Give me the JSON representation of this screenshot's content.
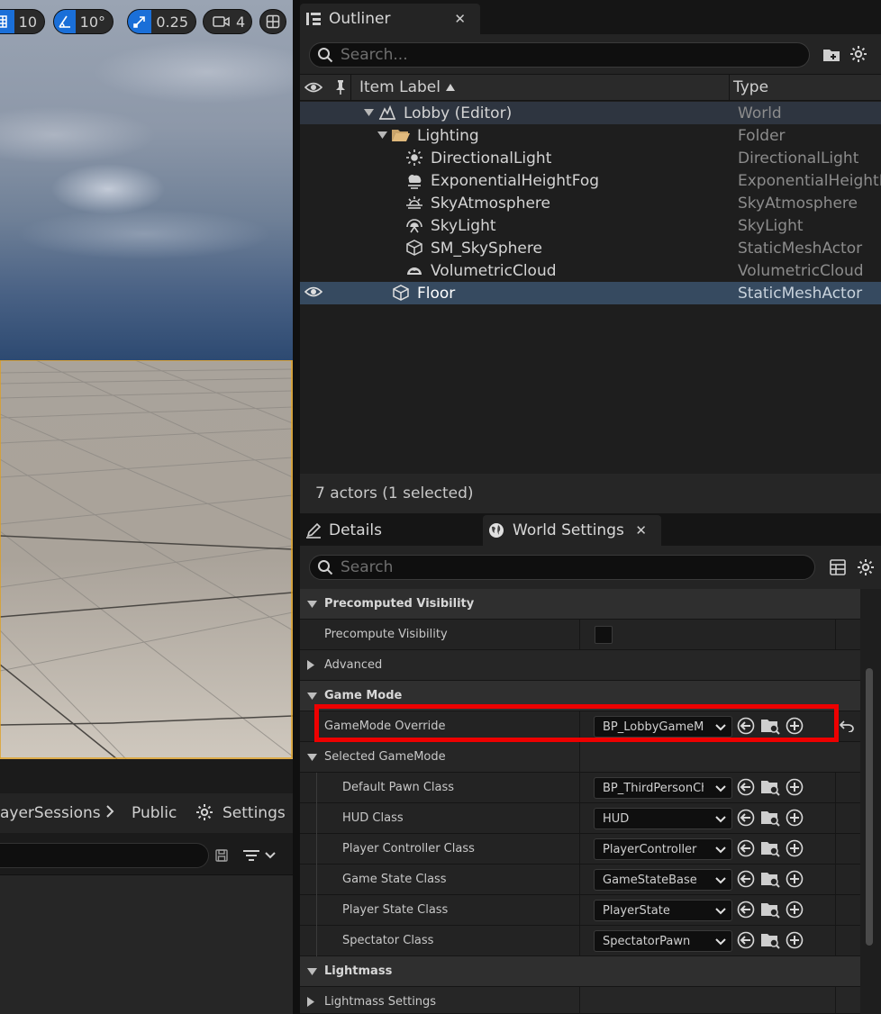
{
  "viewport": {
    "toolbar": {
      "grid_snap_value": "10",
      "rotation_snap_value": "10°",
      "scale_snap_value": "0.25",
      "camera_speed_value": "4"
    }
  },
  "content_browser": {
    "breadcrumb": [
      "ayerSessions",
      "Public"
    ],
    "settings_label": "Settings"
  },
  "outliner": {
    "tab_title": "Outliner",
    "search_placeholder": "Search...",
    "columns": {
      "label": "Item Label",
      "type": "Type"
    },
    "rows": [
      {
        "label": "Lobby (Editor)",
        "type": "World",
        "icon": "world-icon"
      },
      {
        "label": "Lighting",
        "type": "Folder",
        "icon": "folder-icon"
      },
      {
        "label": "DirectionalLight",
        "type": "DirectionalLight",
        "icon": "directional-light-icon"
      },
      {
        "label": "ExponentialHeightFog",
        "type": "ExponentialHeightFog",
        "icon": "height-fog-icon"
      },
      {
        "label": "SkyAtmosphere",
        "type": "SkyAtmosphere",
        "icon": "sky-atmosphere-icon"
      },
      {
        "label": "SkyLight",
        "type": "SkyLight",
        "icon": "sky-light-icon"
      },
      {
        "label": "SM_SkySphere",
        "type": "StaticMeshActor",
        "icon": "static-mesh-icon"
      },
      {
        "label": "VolumetricCloud",
        "type": "VolumetricCloud",
        "icon": "volumetric-cloud-icon"
      },
      {
        "label": "Floor",
        "type": "StaticMeshActor",
        "icon": "static-mesh-icon",
        "selected": true
      }
    ],
    "status": "7 actors (1 selected)"
  },
  "details": {
    "tabs": {
      "details": "Details",
      "world_settings": "World Settings"
    },
    "search_placeholder": "Search",
    "rows": {
      "precomputed_visibility": "Precomputed Visibility",
      "precompute_visibility": "Precompute Visibility",
      "advanced": "Advanced",
      "game_mode": "Game Mode",
      "gamemode_override": "GameMode Override",
      "gamemode_override_value": "BP_LobbyGameMode",
      "selected_gamemode": "Selected GameMode",
      "default_pawn_class": "Default Pawn Class",
      "default_pawn_value": "BP_ThirdPersonCharacter",
      "hud_class": "HUD Class",
      "hud_value": "HUD",
      "player_controller_class": "Player Controller Class",
      "player_controller_value": "PlayerController",
      "game_state_class": "Game State Class",
      "game_state_value": "GameStateBase",
      "player_state_class": "Player State Class",
      "player_state_value": "PlayerState",
      "spectator_class": "Spectator Class",
      "spectator_value": "SpectatorPawn",
      "lightmass": "Lightmass",
      "lightmass_settings": "Lightmass Settings"
    }
  },
  "colors": {
    "accent": "#1a6fd8",
    "selection": "#364a60",
    "highlight_box": "#ee0000"
  }
}
